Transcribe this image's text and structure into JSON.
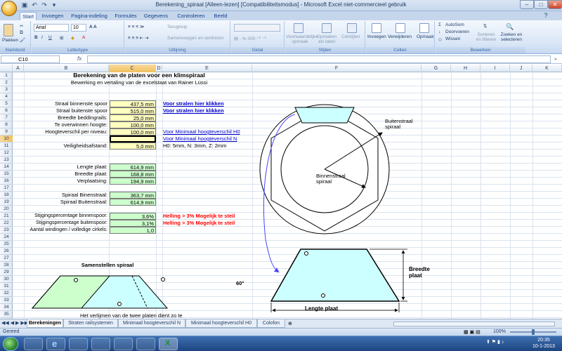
{
  "window": {
    "title": "Berekening_spiraal  [Alleen-lezen]  [Compatibiliteitsmodus]  -  Microsoft Excel niet-commercieel gebruik"
  },
  "ribbon_tabs": [
    "Start",
    "Invoegen",
    "Pagina-indeling",
    "Formules",
    "Gegevens",
    "Controleren",
    "Beeld"
  ],
  "ribbon": {
    "clipboard": {
      "paste": "Plakken",
      "label": "Klembord"
    },
    "font": {
      "name": "Arial",
      "size": "10",
      "label": "Lettertype"
    },
    "alignment": {
      "wrap": "Terugloop",
      "merge": "Samenvoegen en centreren",
      "label": "Uitlijning"
    },
    "number": {
      "label": "Getal"
    },
    "styles": {
      "conditional": "Voorwaardelijke opmaak",
      "table": "Opmaken als tabel",
      "cellstyles": "Celstijlen",
      "label": "Stijlen"
    },
    "cells": {
      "insert": "Invoegen",
      "delete": "Verwijderen",
      "format": "Opmaak",
      "label": "Cellen"
    },
    "editing": {
      "autosum": "AutoSom",
      "fill": "Doorvoeren",
      "clear": "Wissen",
      "sort": "Sorteren en filteren",
      "find": "Zoeken en selecteren",
      "label": "Bewerken"
    }
  },
  "formula_bar": {
    "name_box": "C10",
    "fx": "fx",
    "formula": ""
  },
  "columns": [
    "A",
    "B",
    "C",
    "D",
    "E",
    "F",
    "G",
    "H",
    "I",
    "J",
    "K"
  ],
  "selected_column": "C",
  "selected_row": 10,
  "sheet": {
    "title": "Berekening van de platen voor een klimspiraal",
    "subtitle": "Bewerking en vertaling van de excelstaat van Rainer Lüssi",
    "inputs": [
      {
        "row": 5,
        "label": "Straal binnenste spoor",
        "value": "437,5 mm"
      },
      {
        "row": 6,
        "label": "Straal buitenste spoor",
        "value": "515,0 mm"
      },
      {
        "row": 7,
        "label": "Breedte beddingrails:",
        "value": "25,0 mm"
      },
      {
        "row": 8,
        "label": "Te overwinnen hoogte:",
        "value": "100,0 mm"
      },
      {
        "row": 9,
        "label": "Hoogteverschil per niveau:",
        "value": "100,0 mm"
      },
      {
        "row": 10,
        "label": "",
        "value": ""
      },
      {
        "row": 11,
        "label": "Veiligheidsafstand:",
        "value": "5,0 mm"
      }
    ],
    "links": {
      "r5": "Voor stralen hier klikken",
      "r6": "Voor stralen hier klikken",
      "r9": "Voor Minimaal hoogteverschil H0",
      "r10": "Voor Minimaal hoogteverschil N",
      "r11": "H0: 5mm, N: 3mm, Z: 2mm"
    },
    "results": [
      {
        "row": 13,
        "label": "Lengte plaat:",
        "value": "614,9 mm"
      },
      {
        "row": 14,
        "label": "Breedte plaat:",
        "value": "168,8 mm"
      },
      {
        "row": 15,
        "label": "Verplaatsing:",
        "value": "194,9 mm"
      },
      {
        "row": 17,
        "label": "Spiraal Binenstraal:",
        "value": "363,7 mm"
      },
      {
        "row": 18,
        "label": "Spiraal Buitenstraal:",
        "value": "614,9 mm"
      },
      {
        "row": 20,
        "label": "Stijgingspercentage binnenspoor:",
        "value": "3,6%"
      },
      {
        "row": 21,
        "label": "Stijgingspercentage buitenspoor:",
        "value": "3,1%"
      },
      {
        "row": 22,
        "label": "Aantal windingen / volledige cirkels:",
        "value": "1,0"
      }
    ],
    "warnings": {
      "r20": "Helling > 3% Mogelijk te steil",
      "r21": "Helling > 3% Mogelijk te steil"
    },
    "assembly_title": "Samenstellen spiraal",
    "footer_text": "Het verlijmen van de twee platen dient zo te"
  },
  "diagram": {
    "outer_label": "Buitenstraal spiraal",
    "inner_label": "Binnenstraal spiraal",
    "angle": "60°",
    "width_label": "Breedte plaat",
    "length_label": "Lengte plaat"
  },
  "sheet_tabs": [
    "Berekeningen",
    "Straten railsystemen",
    "Minimaal hoogteverschil N",
    "Minimaal hoogteverschil H0",
    "Colofon"
  ],
  "active_sheet": "Berekeningen",
  "status": {
    "text": "Gereed",
    "zoom": "100%"
  },
  "clock": {
    "time": "20:35",
    "date": "10-1-2013"
  },
  "colors": {
    "input_fill": "#ffffc0",
    "result_fill": "#ccffcc",
    "plate_fill": "#ccffff",
    "link": "#0000cc",
    "warning": "#ff0000",
    "selection": "#f1c15f"
  }
}
